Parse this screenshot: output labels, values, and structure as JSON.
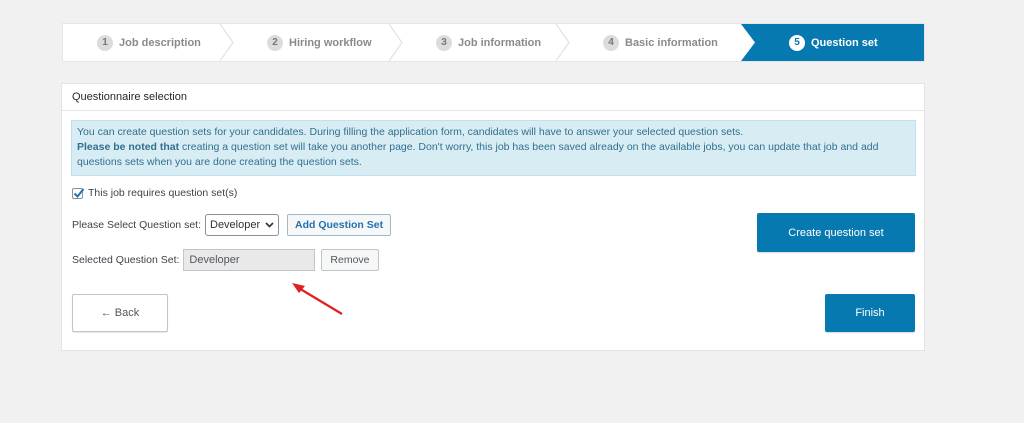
{
  "stepper": {
    "steps": [
      {
        "num": "1",
        "label": "Job description"
      },
      {
        "num": "2",
        "label": "Hiring workflow"
      },
      {
        "num": "3",
        "label": "Job information"
      },
      {
        "num": "4",
        "label": "Basic information"
      },
      {
        "num": "5",
        "label": "Question set"
      }
    ],
    "active_index": 4
  },
  "panel": {
    "title": "Questionnaire selection",
    "notice_line1": "You can create question sets for your candidates. During filling the application form, candidates will have to answer your selected question sets.",
    "notice_bold": "Please be noted that",
    "notice_rest": " creating a question set will take you another page. Don't worry, this job has been saved already on the available jobs, you can update that job and add questions sets when you are done creating the question sets.",
    "checkbox_label": "This job requires question set(s)",
    "checkbox_checked": true,
    "select_label": "Please Select Question set:",
    "select_value": "Developer",
    "add_button": "Add Question Set",
    "selected_label": "Selected Question Set:",
    "selected_value": "Developer",
    "remove_button": "Remove",
    "create_button": "Create question set",
    "back_button": "← Back",
    "finish_button": "Finish"
  },
  "colors": {
    "accent": "#0779b1",
    "notice_bg": "#d8ecf4",
    "annotation_arrow": "#e02020"
  }
}
